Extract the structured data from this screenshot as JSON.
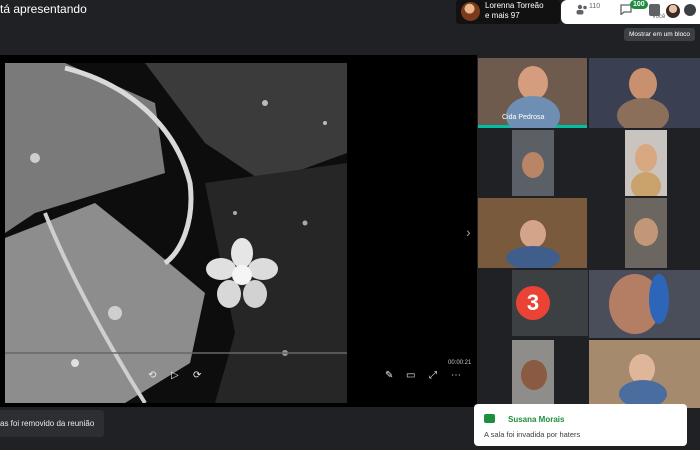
{
  "presenting_text": "tá apresentando",
  "presenter": {
    "name_line1": "Lorenna Torreão",
    "name_line2": "e mais 97"
  },
  "topbar": {
    "people_count": "110",
    "chat_badge": "100",
    "you_label": "Você"
  },
  "tooltip": "Mostrar em um bloco",
  "video": {
    "timestamp": "00:00:21"
  },
  "participants": {
    "active_name": "Cida Pedrosa",
    "raised_hand_number": "3"
  },
  "removed_toast": "as foi removido da reunião",
  "chat_toast": {
    "sender": "Susana Morais",
    "message": "A sala foi invadida por haters"
  },
  "colors": {
    "accent_green": "#1e8e3e",
    "hand_red": "#ea4335",
    "active_border": "#00bfa5"
  },
  "icons": [
    "people-icon",
    "chat-icon",
    "activities-icon",
    "menu-icon",
    "chevron-right-icon",
    "pencil-icon",
    "captions-icon",
    "fullscreen-icon",
    "more-icon",
    "rewind-icon",
    "play-icon",
    "forward-icon"
  ]
}
